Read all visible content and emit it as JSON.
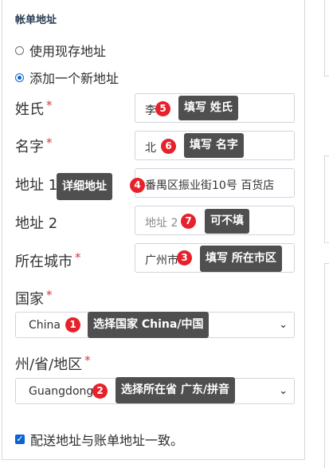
{
  "section": {
    "title": "帐单地址"
  },
  "address_options": {
    "use_existing": "使用现存地址",
    "add_new": "添加一个新地址"
  },
  "fields": {
    "last_name": {
      "label": "姓氏",
      "value": "李",
      "badge": "5",
      "tip": "填写 姓氏"
    },
    "first_name": {
      "label": "名字",
      "value": "北",
      "badge": "6",
      "tip": "填写 名字"
    },
    "address1": {
      "label": "地址 1",
      "value": "番禺区振业街10号 百货店",
      "badge": "4",
      "tip": "详细地址"
    },
    "address2": {
      "label": "地址 2",
      "placeholder": "地址 2",
      "badge": "7",
      "tip": "可不填"
    },
    "city": {
      "label": "所在城市",
      "value": "广州市",
      "badge": "3",
      "tip": "填写 所在市区"
    },
    "country": {
      "label": "国家",
      "selected": "China",
      "badge": "1",
      "tip": "选择国家 China/中国"
    },
    "province": {
      "label": "州/省/地区",
      "selected": "Guangdong",
      "badge": "2",
      "tip": "选择所在省 广东/拼音"
    }
  },
  "shipping_same": {
    "label": "配送地址与账单地址一致。"
  },
  "required_mark": "*",
  "colors": {
    "badge": "#e6212b",
    "tooltip": "#4f4f4f",
    "accent": "#0d63d4"
  }
}
